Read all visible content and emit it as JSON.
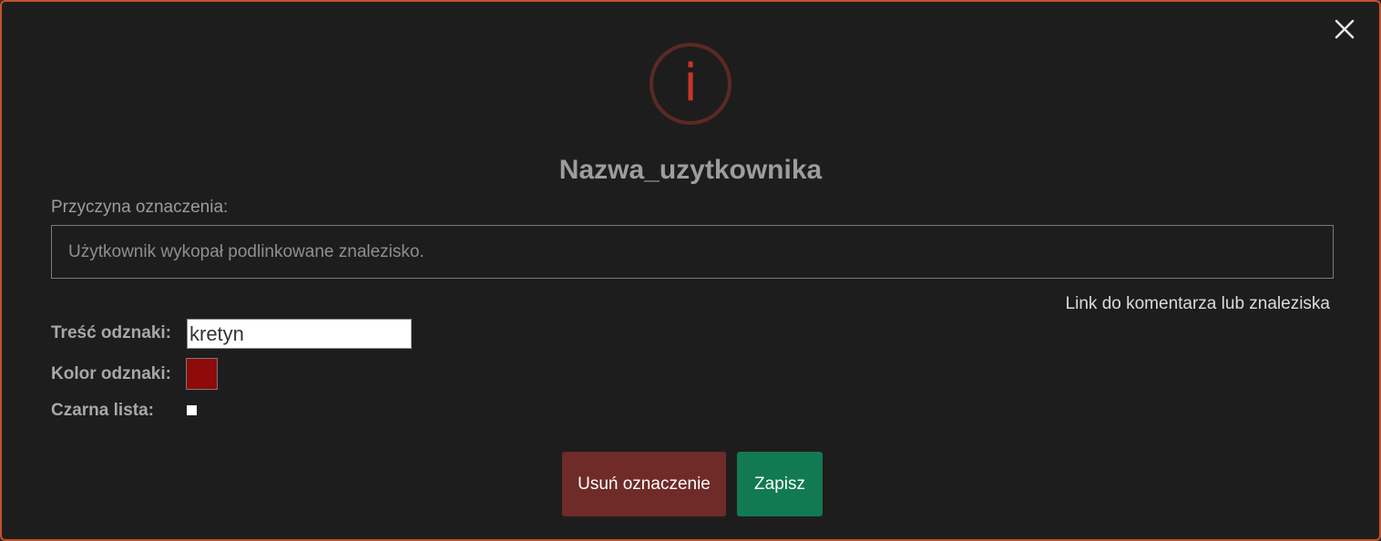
{
  "dialog": {
    "title": "Nazwa_uzytkownika",
    "info_symbol": "i",
    "close_symbol": "×"
  },
  "reason": {
    "label": "Przyczyna oznaczenia:",
    "placeholder": "Użytkownik wykopał podlinkowane znalezisko.",
    "link_text": "Link do komentarza lub znaleziska"
  },
  "badge": {
    "text_label": "Treść odznaki:",
    "text_value": "kretyn",
    "color_label": "Kolor odznaki:",
    "color_value": "#8f0b0b"
  },
  "blacklist": {
    "label": "Czarna lista:",
    "checked": false
  },
  "buttons": {
    "remove_label": "Usuń oznaczenie",
    "save_label": "Zapisz"
  },
  "colors": {
    "accent_border": "#c4532f",
    "remove_button": "#6f2b27",
    "save_button": "#117a52",
    "info_icon": "#c7362a"
  }
}
